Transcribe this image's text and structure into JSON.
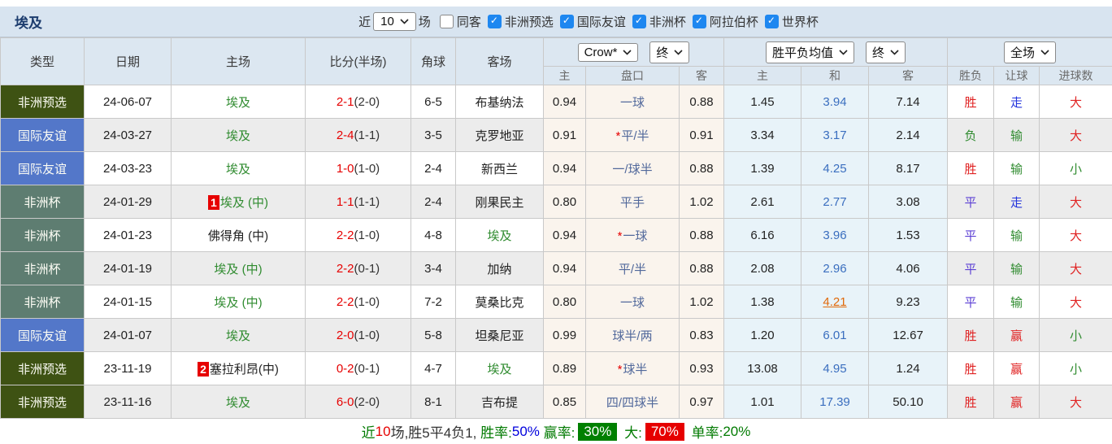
{
  "title": "埃及",
  "filters": {
    "near_label": "近",
    "near_value": "10",
    "games_label": "场",
    "checkboxes": [
      {
        "label": "同客",
        "checked": false
      },
      {
        "label": "非洲预选",
        "checked": true
      },
      {
        "label": "国际友谊",
        "checked": true
      },
      {
        "label": "非洲杯",
        "checked": true
      },
      {
        "label": "阿拉伯杯",
        "checked": true
      },
      {
        "label": "世界杯",
        "checked": true
      }
    ]
  },
  "header": {
    "type": "类型",
    "date": "日期",
    "home": "主场",
    "score": "比分(半场)",
    "corner": "角球",
    "away": "客场",
    "ah_home": "主",
    "handicap": "盘口",
    "ah_away": "客",
    "eu_home": "主",
    "eu_draw": "和",
    "eu_away": "客",
    "result": "胜负",
    "let_ball": "让球",
    "goals": "进球数",
    "dropdowns": {
      "bookmaker": "Crow*",
      "bookmaker_period": "终",
      "europe": "胜平负均值",
      "europe_period": "终",
      "scope": "全场"
    }
  },
  "colors": {
    "type_badge": {
      "非洲预选": "#3e5213",
      "国际友谊": "#5377c9",
      "非洲杯": "#5e7d71"
    },
    "focus_team": "#2f8b2f",
    "score": "#e60000",
    "handicap_text": "#51689b",
    "draw_odds": "#3a6ebf",
    "highlight_odds": "#e0690a",
    "win": "#e02222",
    "draw": "#5b3fd4",
    "lose": "#2f8b2f",
    "push": "#2233dd",
    "big": "#e02222",
    "small": "#2f8b2f"
  },
  "rows": [
    {
      "type": "非洲预选",
      "date": "24-06-07",
      "home_badge": "",
      "home": "埃及",
      "home_focus": true,
      "score": "2-1",
      "half": "(2-0)",
      "corner": "6-5",
      "away": "布基纳法",
      "away_focus": false,
      "ah_home": "0.94",
      "star": false,
      "handicap": "一球",
      "ah_away": "0.88",
      "eu_home": "1.45",
      "eu_draw": "3.94",
      "eu_away": "7.14",
      "eu_draw_hl": false,
      "result": "胜",
      "let": "走",
      "goals": "大"
    },
    {
      "type": "国际友谊",
      "date": "24-03-27",
      "home_badge": "",
      "home": "埃及",
      "home_focus": true,
      "score": "2-4",
      "half": "(1-1)",
      "corner": "3-5",
      "away": "克罗地亚",
      "away_focus": false,
      "ah_home": "0.91",
      "star": true,
      "handicap": "平/半",
      "ah_away": "0.91",
      "eu_home": "3.34",
      "eu_draw": "3.17",
      "eu_away": "2.14",
      "eu_draw_hl": false,
      "result": "负",
      "let": "输",
      "goals": "大"
    },
    {
      "type": "国际友谊",
      "date": "24-03-23",
      "home_badge": "",
      "home": "埃及",
      "home_focus": true,
      "score": "1-0",
      "half": "(1-0)",
      "corner": "2-4",
      "away": "新西兰",
      "away_focus": false,
      "ah_home": "0.94",
      "star": false,
      "handicap": "一/球半",
      "ah_away": "0.88",
      "eu_home": "1.39",
      "eu_draw": "4.25",
      "eu_away": "8.17",
      "eu_draw_hl": false,
      "result": "胜",
      "let": "输",
      "goals": "小"
    },
    {
      "type": "非洲杯",
      "date": "24-01-29",
      "home_badge": "1",
      "home": "埃及 (中)",
      "home_focus": true,
      "score": "1-1",
      "half": "(1-1)",
      "corner": "2-4",
      "away": "刚果民主",
      "away_focus": false,
      "ah_home": "0.80",
      "star": false,
      "handicap": "平手",
      "ah_away": "1.02",
      "eu_home": "2.61",
      "eu_draw": "2.77",
      "eu_away": "3.08",
      "eu_draw_hl": false,
      "result": "平",
      "let": "走",
      "goals": "大"
    },
    {
      "type": "非洲杯",
      "date": "24-01-23",
      "home_badge": "",
      "home": "佛得角 (中)",
      "home_focus": false,
      "score": "2-2",
      "half": "(1-0)",
      "corner": "4-8",
      "away": "埃及",
      "away_focus": true,
      "ah_home": "0.94",
      "star": true,
      "handicap": "一球",
      "ah_away": "0.88",
      "eu_home": "6.16",
      "eu_draw": "3.96",
      "eu_away": "1.53",
      "eu_draw_hl": false,
      "result": "平",
      "let": "输",
      "goals": "大"
    },
    {
      "type": "非洲杯",
      "date": "24-01-19",
      "home_badge": "",
      "home": "埃及 (中)",
      "home_focus": true,
      "score": "2-2",
      "half": "(0-1)",
      "corner": "3-4",
      "away": "加纳",
      "away_focus": false,
      "ah_home": "0.94",
      "star": false,
      "handicap": "平/半",
      "ah_away": "0.88",
      "eu_home": "2.08",
      "eu_draw": "2.96",
      "eu_away": "4.06",
      "eu_draw_hl": false,
      "result": "平",
      "let": "输",
      "goals": "大"
    },
    {
      "type": "非洲杯",
      "date": "24-01-15",
      "home_badge": "",
      "home": "埃及 (中)",
      "home_focus": true,
      "score": "2-2",
      "half": "(1-0)",
      "corner": "7-2",
      "away": "莫桑比克",
      "away_focus": false,
      "ah_home": "0.80",
      "star": false,
      "handicap": "一球",
      "ah_away": "1.02",
      "eu_home": "1.38",
      "eu_draw": "4.21",
      "eu_away": "9.23",
      "eu_draw_hl": true,
      "result": "平",
      "let": "输",
      "goals": "大"
    },
    {
      "type": "国际友谊",
      "date": "24-01-07",
      "home_badge": "",
      "home": "埃及",
      "home_focus": true,
      "score": "2-0",
      "half": "(1-0)",
      "corner": "5-8",
      "away": "坦桑尼亚",
      "away_focus": false,
      "ah_home": "0.99",
      "star": false,
      "handicap": "球半/两",
      "ah_away": "0.83",
      "eu_home": "1.20",
      "eu_draw": "6.01",
      "eu_away": "12.67",
      "eu_draw_hl": false,
      "result": "胜",
      "let": "赢",
      "goals": "小"
    },
    {
      "type": "非洲预选",
      "date": "23-11-19",
      "home_badge": "2",
      "home": "塞拉利昂(中)",
      "home_focus": false,
      "score": "0-2",
      "half": "(0-1)",
      "corner": "4-7",
      "away": "埃及",
      "away_focus": true,
      "ah_home": "0.89",
      "star": true,
      "handicap": "球半",
      "ah_away": "0.93",
      "eu_home": "13.08",
      "eu_draw": "4.95",
      "eu_away": "1.24",
      "eu_draw_hl": false,
      "result": "胜",
      "let": "赢",
      "goals": "小"
    },
    {
      "type": "非洲预选",
      "date": "23-11-16",
      "home_badge": "",
      "home": "埃及",
      "home_focus": true,
      "score": "6-0",
      "half": "(2-0)",
      "corner": "8-1",
      "away": "吉布提",
      "away_focus": false,
      "ah_home": "0.85",
      "star": false,
      "handicap": "四/四球半",
      "ah_away": "0.97",
      "eu_home": "1.01",
      "eu_draw": "17.39",
      "eu_away": "50.10",
      "eu_draw_hl": false,
      "result": "胜",
      "let": "赢",
      "goals": "大"
    }
  ],
  "summary_segments": [
    {
      "text": "近",
      "style": "green"
    },
    {
      "text": "10",
      "style": "red"
    },
    {
      "text": "场,胜5平4负1, ",
      "style": "dark"
    },
    {
      "text": "胜率:",
      "style": "green"
    },
    {
      "text": "50%",
      "style": "blue"
    },
    {
      "text": " 赢率:",
      "style": "green"
    },
    {
      "text": "30%",
      "style": "green-box"
    },
    {
      "text": " 大:",
      "style": "green"
    },
    {
      "text": "70%",
      "style": "red-box"
    },
    {
      "text": " 单率:",
      "style": "green"
    },
    {
      "text": "20%",
      "style": "green"
    }
  ]
}
